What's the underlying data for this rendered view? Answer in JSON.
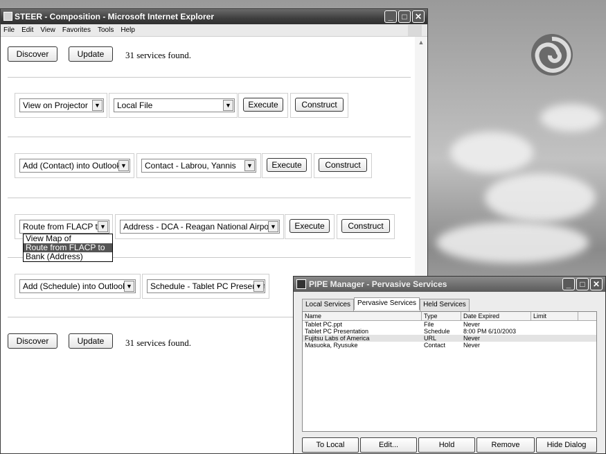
{
  "ie": {
    "title": "STEER - Composition - Microsoft Internet Explorer",
    "window_buttons": [
      "_",
      "□",
      "✕"
    ],
    "menu": [
      "File",
      "Edit",
      "View",
      "Favorites",
      "Tools",
      "Help"
    ]
  },
  "page": {
    "discover_label": "Discover",
    "update_label": "Update",
    "status_text": "31 services found.",
    "execute_label": "Execute",
    "construct_label": "Construct",
    "rows": [
      {
        "action": "View on Projector",
        "target": "Local File"
      },
      {
        "action": "Add (Contact) into Outlook",
        "target": "Contact - Labrou, Yannis"
      },
      {
        "action": "Route from FLACP to",
        "target": "Address - DCA - Reagan National Airport"
      },
      {
        "action": "Add (Schedule) into Outlook",
        "target": "Schedule - Tablet PC Presentation"
      }
    ],
    "dropdown_options": [
      "View Map of",
      "Route from FLACP to",
      "Bank (Address)"
    ],
    "dropdown_selected": "Route from FLACP to"
  },
  "pipe": {
    "title": "PIPE Manager - Pervasive Services",
    "tabs": [
      "Local Services",
      "Pervasive Services",
      "Held Services"
    ],
    "active_tab": "Pervasive Services",
    "columns": [
      "Name",
      "Type",
      "Date Expired",
      "Limit"
    ],
    "rows": [
      {
        "name": "Tablet PC.ppt",
        "type": "File",
        "date": "Never",
        "limit": ""
      },
      {
        "name": "Tablet PC Presentation",
        "type": "Schedule",
        "date": "8:00 PM 6/10/2003",
        "limit": ""
      },
      {
        "name": "Fujitsu Labs of America",
        "type": "URL",
        "date": "Never",
        "limit": ""
      },
      {
        "name": "Masuoka, Ryusuke",
        "type": "Contact",
        "date": "Never",
        "limit": ""
      }
    ],
    "buttons": {
      "to_local": "To Local",
      "edit": "Edit...",
      "hold": "Hold",
      "remove": "Remove",
      "hide": "Hide Dialog"
    }
  }
}
